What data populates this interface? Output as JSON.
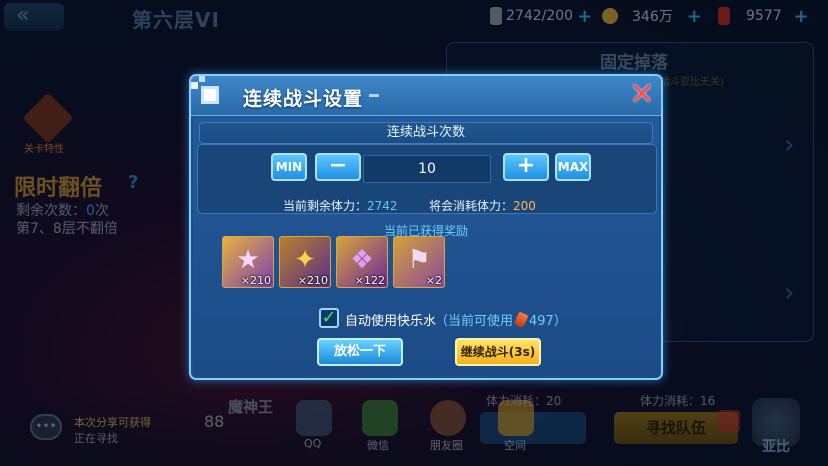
{
  "topbar": {
    "floor_title": "第六层VI",
    "stamina": "2742/200",
    "gold": "346万",
    "gems": "9577"
  },
  "left": {
    "stage_label": "关卡特性",
    "limited_title": "限时翻倍",
    "remain_prefix": "剩余次数：",
    "remain_count": "0",
    "remain_suffix": "次",
    "no_double": "第7、8层不翻倍"
  },
  "right": {
    "fixed_drop": "固定掉落",
    "drop_note": "战斗亚比无关)"
  },
  "bottom": {
    "chat_line1": "本次分享可获得",
    "chat_line2": "正在寻找",
    "boss_name": "魔神王",
    "power": "88",
    "qq": "QQ",
    "wechat": "微信",
    "moments": "朋友圈",
    "space": "空间",
    "cost_left": "体力消耗：20",
    "cost_right": "体力消耗：16",
    "find_team": "寻找队伍",
    "yabi": "亚比"
  },
  "dialog": {
    "title": "连续战斗设置",
    "close": "✕",
    "subheader": "连续战斗次数",
    "min": "MIN",
    "minus": "−",
    "count": "10",
    "plus": "+",
    "max": "MAX",
    "remaining_label": "当前剩余体力：",
    "remaining_value": "2742",
    "cost_label": "将会消耗体力：",
    "cost_value": "200",
    "rewards_title": "当前已获得奖励",
    "rewards": [
      {
        "qty": "×210",
        "icon": "star-icon"
      },
      {
        "qty": "×210",
        "icon": "potion-icon"
      },
      {
        "qty": "×122",
        "icon": "wings-icon"
      },
      {
        "qty": "×2",
        "icon": "boots-icon"
      }
    ],
    "auto_checked": true,
    "auto_label": "自动使用快乐水",
    "avail_open": "（当前可使用",
    "avail_value": "497",
    "avail_close": "）",
    "relax_button": "放松一下",
    "continue_button": "继续战斗(3s)"
  },
  "colors": {
    "accent_blue": "#5cc8ff",
    "accent_orange": "#ffb84d",
    "close_red": "#ff4c4c",
    "continue_yellow": "#f0b21c"
  }
}
